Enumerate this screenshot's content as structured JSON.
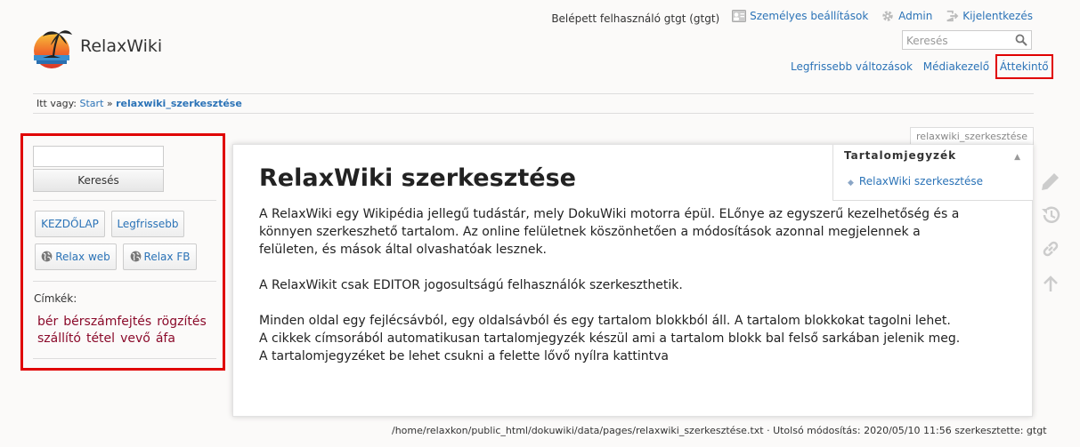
{
  "site": {
    "title": "RelaxWiki"
  },
  "user_bar": {
    "logged_in_text": "Belépett felhasználó gtgt (gtgt)",
    "settings_label": "Személyes beállítások",
    "admin_label": "Admin",
    "logout_label": "Kijelentkezés"
  },
  "search": {
    "placeholder": "Keresés"
  },
  "header_links": {
    "recent_changes": "Legfrissebb változások",
    "media_manager": "Médiakezelő",
    "overview": "Áttekintő"
  },
  "breadcrumb": {
    "prefix": "Itt vagy:",
    "start": "Start",
    "separator": "»",
    "current": "relaxwiki_szerkesztése"
  },
  "sidebar": {
    "search_button": "Keresés",
    "buttons": {
      "home": "KEZDŐLAP",
      "latest": "Legfrissebb",
      "relax_web": "Relax web",
      "relax_fb": "Relax FB"
    },
    "tags_label": "Címkék:",
    "tags": [
      "bér",
      "bérszámfejtés",
      "rögzítés",
      "szállító",
      "tétel",
      "vevő",
      "áfa"
    ]
  },
  "page": {
    "id": "relaxwiki_szerkesztése",
    "title": "RelaxWiki szerkesztése",
    "paragraphs": [
      "A RelaxWiki egy Wikipédia jellegű tudástár, mely DokuWiki motorra épül. ELőnye az egyszerű kezelhetőség és a könnyen szerkeszhető tartalom. Az online felületnek köszönhetően a módosítások azonnal megjelennek a felületen, és mások által olvashatóak lesznek.",
      "A RelaxWikit csak EDITOR jogosultságú felhasználók szerkeszthetik.",
      "Minden oldal egy fejlécsávból, egy oldalsávból és egy tartalom blokkból áll. A tartalom blokkokat tagolni lehet. A cikkek címsorából automatikusan tartalomjegyzék készül ami a tartalom blokk bal felső sarkában jelenik meg. A tartalomjegyzéket be lehet csukni a felette lővő nyílra kattintva"
    ]
  },
  "toc": {
    "title": "Tartalomjegyzék",
    "items": [
      "RelaxWiki szerkesztése"
    ]
  },
  "footer": {
    "text": "/home/relaxkon/public_html/dokuwiki/data/pages/relaxwiki_szerkesztése.txt · Utolsó módosítás: 2020/05/10 11:56 szerkesztette: gtgt"
  },
  "colors": {
    "link": "#2b73b7",
    "tag": "#8b0b2b",
    "highlight": "#e00000"
  },
  "icons": [
    "logo-icon",
    "user-settings-icon",
    "admin-gear-icon",
    "logout-icon",
    "search-icon",
    "globe-icon",
    "edit-pencil-icon",
    "revisions-icon",
    "backlinks-icon",
    "back-to-top-icon"
  ]
}
